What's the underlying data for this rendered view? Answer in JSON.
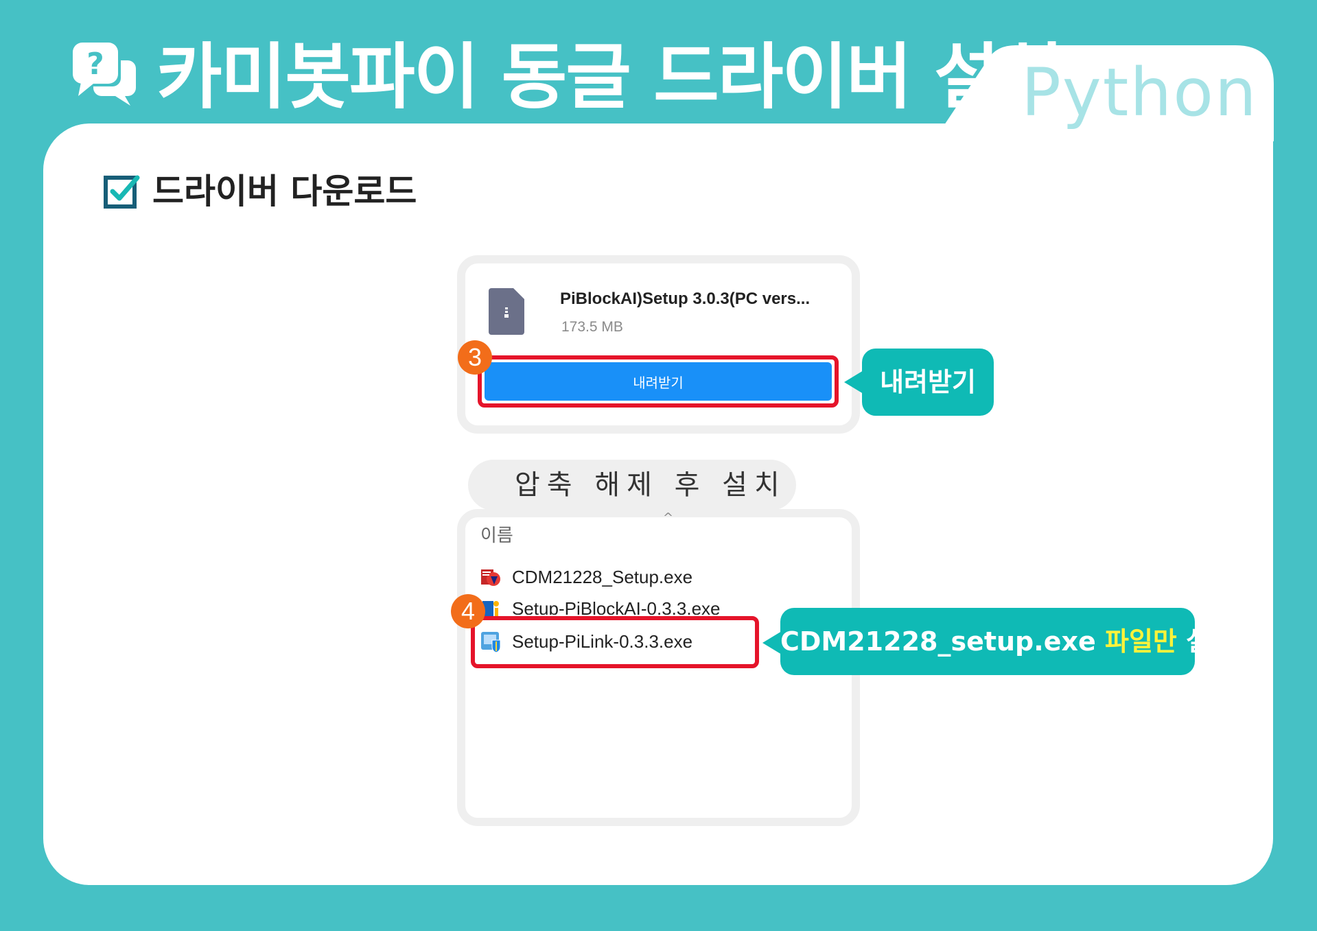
{
  "header": {
    "title": "카미봇파이 동글 드라이버 설치",
    "tab_label": "Python"
  },
  "section": {
    "title": "드라이버 다운로드"
  },
  "download_panel": {
    "file_name": "PiBlockAI)Setup 3.0.3(PC vers...",
    "file_size": "173.5 MB",
    "download_button": "내려받기"
  },
  "steps": {
    "step_3": "3",
    "step_4": "4"
  },
  "callouts": {
    "download": "내려받기",
    "install_part1": "CDM21228_setup.exe ",
    "install_highlight": "파일만",
    "install_part2": " 설치"
  },
  "extract_label": "압축 해제 후 설치",
  "file_list": {
    "column_header": "이름",
    "files": [
      {
        "name": "CDM21228_Setup.exe"
      },
      {
        "name": "Setup-PiBlockAI-0.3.3.exe"
      },
      {
        "name": "Setup-PiLink-0.3.3.exe"
      }
    ]
  },
  "colors": {
    "background": "#46c1c5",
    "accent": "#0fbab5",
    "highlight_box": "#e5142a",
    "step_badge": "#f26d1a",
    "button": "#1990f8",
    "callout_highlight": "#fff33a"
  }
}
